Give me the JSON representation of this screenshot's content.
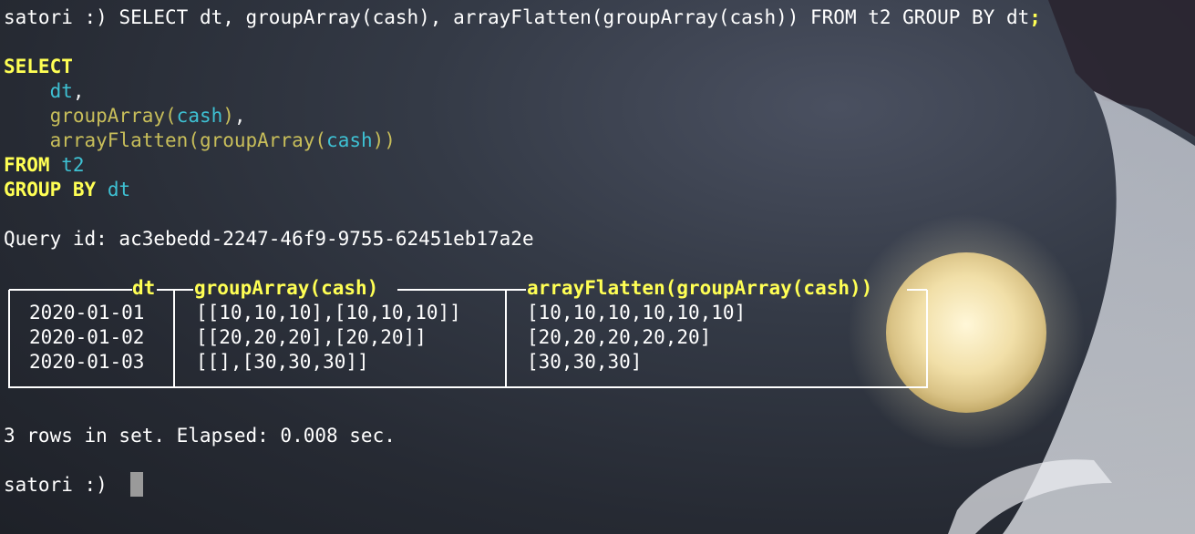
{
  "prompt": "satori :)",
  "command": {
    "prefix": " SELECT dt, groupArray(cash), arrayFlatten(groupArray(cash)) FROM t2 GROUP BY dt",
    "terminator": ";"
  },
  "formatted": {
    "select_kw": "SELECT",
    "col1": "dt",
    "comma": ",",
    "fn_group": "groupArray",
    "arg_cash": "cash",
    "fn_flatten": "arrayFlatten",
    "from_kw": "FROM",
    "table": "t2",
    "group_kw": "GROUP BY",
    "group_col": "dt"
  },
  "query_id_line": "Query id: ac3ebedd-2247-46f9-9755-62451eb17a2e",
  "result": {
    "headers": [
      "dt",
      "groupArray(cash)",
      "arrayFlatten(groupArray(cash))"
    ],
    "rows": [
      [
        "2020-01-01",
        "[[10,10,10],[10,10,10]]",
        "[10,10,10,10,10,10]"
      ],
      [
        "2020-01-02",
        "[[20,20,20],[20,20]]",
        "[20,20,20,20,20]"
      ],
      [
        "2020-01-03",
        "[[],[30,30,30]]",
        "[30,30,30]"
      ]
    ]
  },
  "summary": "3 rows in set. Elapsed: 0.008 sec.",
  "cursor_prompt": "satori :)",
  "colors": {
    "keyword": "#ffff54",
    "identifier": "#3ec1d3",
    "function": "#c8be5a",
    "text": "#ffffff"
  }
}
